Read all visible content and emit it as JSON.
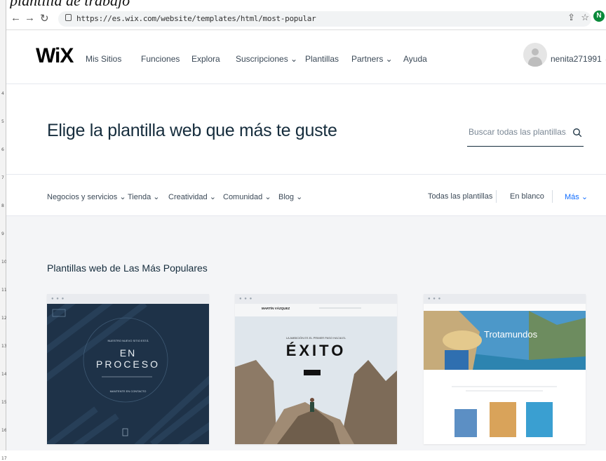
{
  "document_caption": "plantilla de trabajo",
  "ruler_marks": [
    "4",
    "5",
    "6",
    "7",
    "8",
    "9",
    "10",
    "11",
    "12",
    "13",
    "14",
    "15",
    "16",
    "17"
  ],
  "browser": {
    "url": "https://es.wix.com/website/templates/html/most-popular",
    "profile_initial": "N"
  },
  "nav": {
    "logo": "WiX",
    "items": [
      "Mis Sitios",
      "Funciones",
      "Explora",
      "Suscripciones ⌄",
      "Plantillas",
      "Partners ⌄",
      "Ayuda"
    ],
    "username": "nenita271991 ⌄"
  },
  "hero": {
    "title": "Elige la plantilla web que más te guste",
    "search_placeholder": "Buscar todas las plantillas..."
  },
  "categories": {
    "left": [
      "Negocios y servicios ⌄",
      "Tienda ⌄",
      "Creatividad ⌄",
      "Comunidad ⌄",
      "Blog ⌄"
    ],
    "right": [
      "Todas las plantillas",
      "En blanco",
      "Más ⌄"
    ]
  },
  "section": {
    "title": "Plantillas web de Las Más Populares"
  },
  "templates": [
    {
      "headline_line1": "EN",
      "headline_line2": "PROCESO",
      "tagline": "NUESTRO NUEVO SITIO ESTÁ",
      "subline": "MANTENTE EN CONTACTO",
      "colors": {
        "bg": "#1e3248",
        "accent": "#2f4b66"
      }
    },
    {
      "brand": "MARTÍN VÁZQUEZ",
      "headline": "ÉXITO",
      "tagline": "LA AMBICIÓN ES EL PRIMER PASO HACIA EL",
      "colors": {
        "sky": "#dfe6ec",
        "rock": "#7d6b58"
      }
    },
    {
      "headline": "Trotamundos",
      "colors": {
        "sky": "#4c98c9",
        "sea": "#2d84b0"
      }
    }
  ],
  "colors": {
    "accent": "#116dff",
    "text": "#162d3d",
    "page_bg": "#f4f5f7"
  }
}
